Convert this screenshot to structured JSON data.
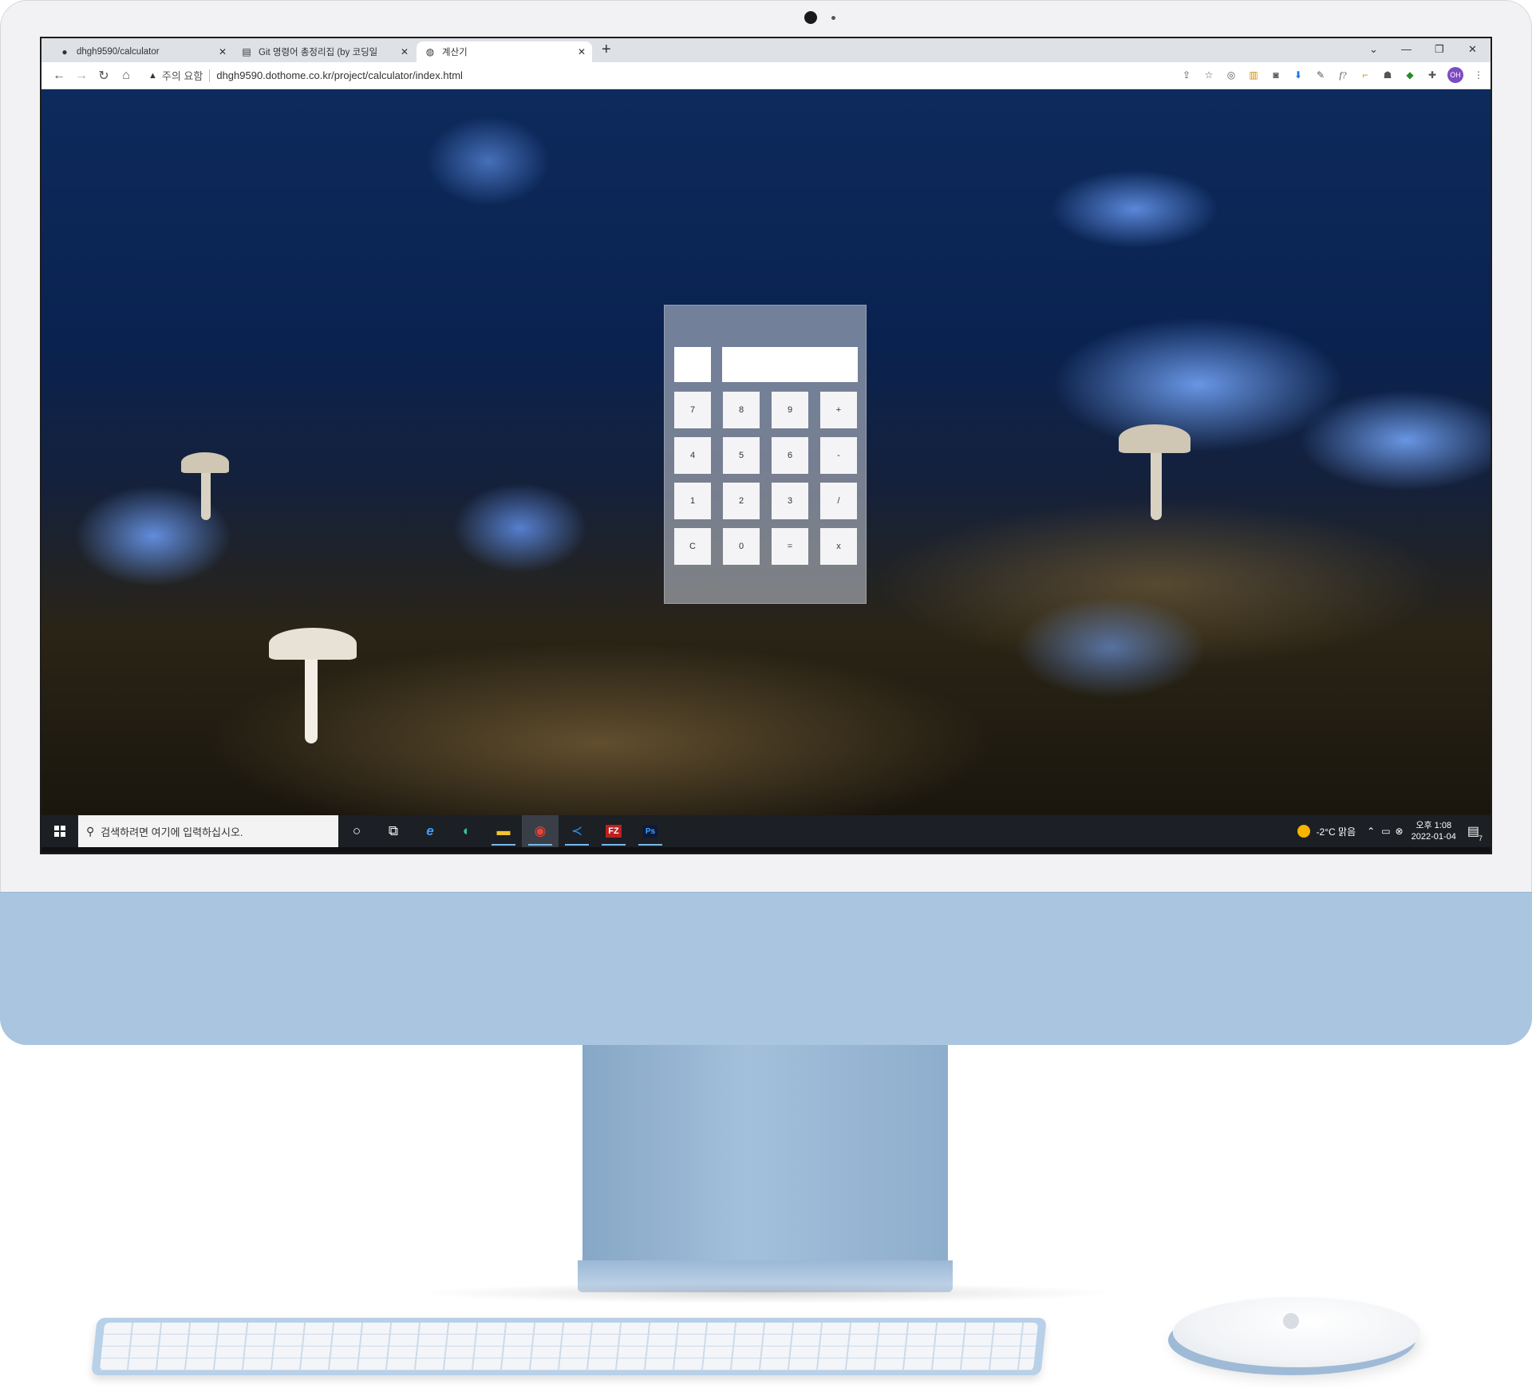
{
  "browser": {
    "tabs": [
      {
        "icon": "github-icon",
        "label": "dhgh9590/calculator"
      },
      {
        "icon": "document-icon",
        "label": "Git 명령어 총정리집 (by 코딩일"
      },
      {
        "icon": "globe-icon",
        "label": "계산기"
      }
    ],
    "security_label": "주의 요함",
    "url": "dhgh9590.dothome.co.kr/project/calculator/index.html",
    "profile_initials": "OH"
  },
  "calculator": {
    "keys": [
      "7",
      "8",
      "9",
      "+",
      "4",
      "5",
      "6",
      "-",
      "1",
      "2",
      "3",
      "/",
      "C",
      "0",
      "=",
      "x"
    ]
  },
  "taskbar": {
    "search_placeholder": "검색하려면 여기에 입력하십시오.",
    "weather": "-2°C 맑음",
    "time": "오후 1:08",
    "date": "2022-01-04",
    "notification_count": "7",
    "apps": [
      "cortana-icon",
      "task-view-icon",
      "ie-icon",
      "edge-icon",
      "file-explorer-icon",
      "chrome-icon",
      "vscode-icon",
      "filezilla-icon",
      "photoshop-icon"
    ]
  },
  "colors": {
    "device": "#a9c5e0",
    "taskbar": "#1c1f24",
    "profile": "#7e4ac2"
  }
}
